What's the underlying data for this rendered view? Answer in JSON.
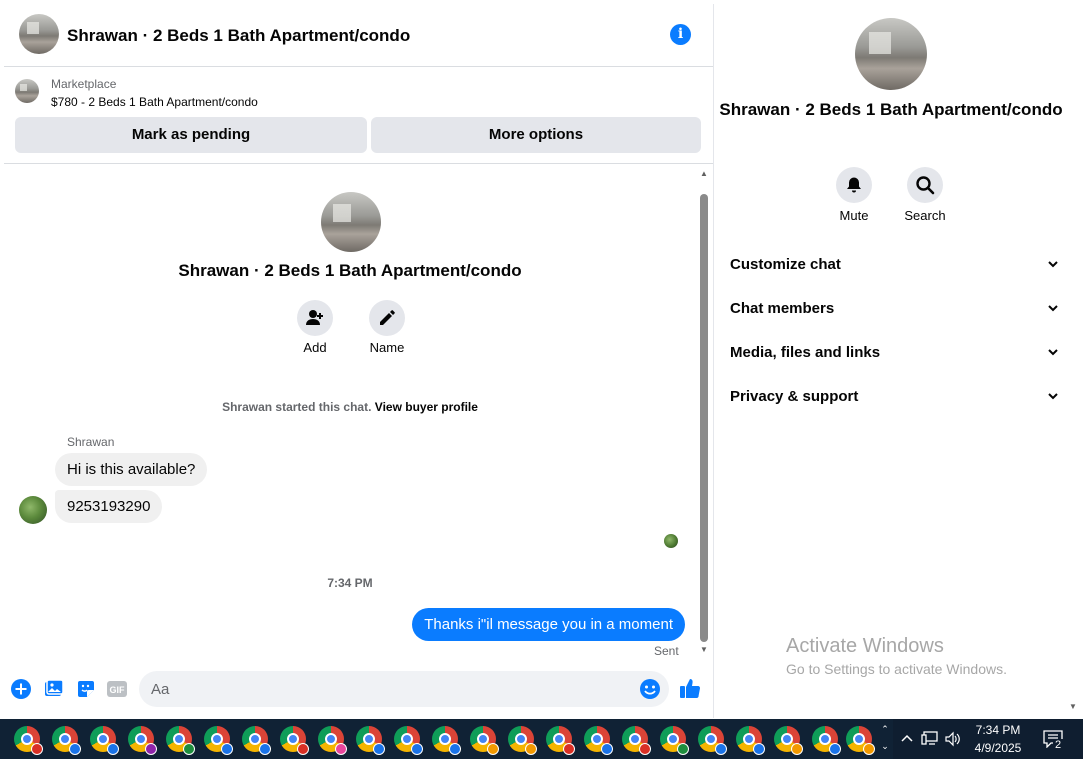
{
  "header": {
    "title": "Shrawan · 2 Beds 1 Bath Apartment/condo",
    "info_icon": "info-icon"
  },
  "marketplace": {
    "label": "Marketplace",
    "listing": "$780 - 2 Beds 1 Bath Apartment/condo",
    "mark_pending_label": "Mark as pending",
    "more_options_label": "More options"
  },
  "chat_intro": {
    "title": "Shrawan · 2 Beds 1 Bath Apartment/condo",
    "add_label": "Add",
    "name_label": "Name",
    "started_text": "Shrawan started this chat. ",
    "view_profile_link": "View buyer profile"
  },
  "messages": {
    "sender_name": "Shrawan",
    "incoming": [
      "Hi is this available?",
      "9253193290"
    ],
    "timestamp": "7:34 PM",
    "outgoing": "Thanks i\"il message you in a moment",
    "status": "Sent"
  },
  "composer": {
    "placeholder": "Aa",
    "icons": [
      "plus-circle-icon",
      "photo-icon",
      "sticker-icon",
      "gif-icon",
      "emoji-icon",
      "thumbs-up-icon"
    ]
  },
  "info_panel": {
    "title": "Shrawan · 2 Beds 1 Bath Apartment/condo",
    "mute_label": "Mute",
    "search_label": "Search",
    "sections": [
      "Customize chat",
      "Chat members",
      "Media, files and links",
      "Privacy & support"
    ]
  },
  "watermark": {
    "line1": "Activate Windows",
    "line2": "Go to Settings to activate Windows."
  },
  "taskbar": {
    "time": "7:34 PM",
    "date": "4/9/2025",
    "notification_count": "2"
  },
  "colors": {
    "accent": "#0a7cff",
    "bubble_in": "#f0f0f0",
    "button_gray": "#e4e6eb",
    "taskbar": "#102235"
  }
}
